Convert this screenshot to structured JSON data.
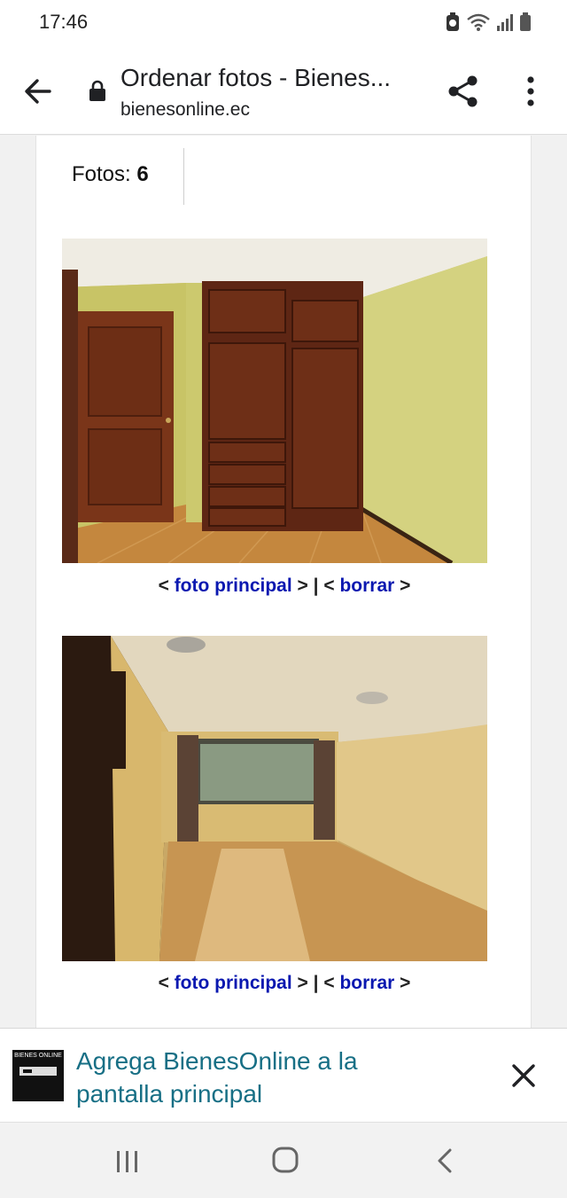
{
  "status_bar": {
    "time": "17:46",
    "icons": [
      "battery-saver-icon",
      "wifi-icon",
      "signal-icon",
      "battery-icon"
    ]
  },
  "toolbar": {
    "title": "Ordenar fotos - Bienes...",
    "url": "bienesonline.ec",
    "icons": [
      "back-arrow-icon",
      "lock-icon",
      "share-icon",
      "more-vert-icon"
    ]
  },
  "page": {
    "fotos_label": "Fotos:",
    "fotos_count": "6",
    "photos": [
      {
        "actions": {
          "open": "<",
          "primary_link": "foto principal",
          "separator": "> | <",
          "delete_link": "borrar",
          "close": ">"
        }
      },
      {
        "actions": {
          "open": "<",
          "primary_link": "foto principal",
          "separator": "> | <",
          "delete_link": "borrar",
          "close": ">"
        }
      }
    ]
  },
  "install_banner": {
    "logo_text": "BIENES ONLINE",
    "text": "Agrega BienesOnline a la pantalla principal"
  },
  "nav_bar": {
    "icons": [
      "recents-icon",
      "home-icon",
      "back-icon"
    ]
  },
  "colors": {
    "link": "#0a18b0",
    "banner_text": "#176f85"
  }
}
